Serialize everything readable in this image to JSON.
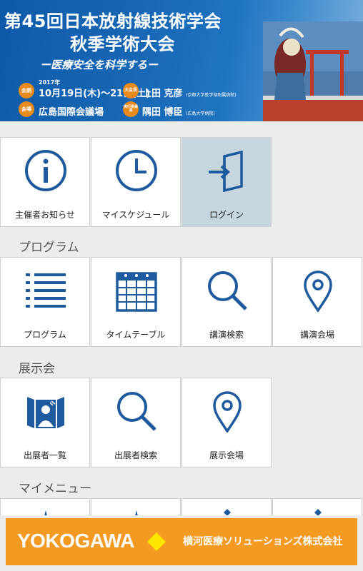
{
  "banner": {
    "title_line1": "第45回日本放射線技術学会",
    "title_line2": "秋季学術大会",
    "subtitle": "ー医療安全を科学するー",
    "session_badge": "会期",
    "year": "2017年",
    "dates": "10月19日(木)～21日(土)",
    "venue_badge": "会場",
    "venue": "広島国際会議場",
    "president_badge": "大会長",
    "president_name": "上田 克彦",
    "president_affil": "(京都大学医学部附属病院)",
    "chair_badge": "実行委員長",
    "chair_name": "隅田 博臣",
    "chair_affil": "(広島大学病院)"
  },
  "top_tiles": [
    {
      "label": "主催者お知らせ",
      "icon": "info-icon"
    },
    {
      "label": "マイスケジュール",
      "icon": "clock-icon"
    },
    {
      "label": "ログイン",
      "icon": "login-icon"
    }
  ],
  "sections": {
    "program": {
      "heading": "プログラム",
      "tiles": [
        {
          "label": "プログラム",
          "icon": "list-icon"
        },
        {
          "label": "タイムテーブル",
          "icon": "calendar-icon"
        },
        {
          "label": "講演検索",
          "icon": "search-icon"
        },
        {
          "label": "講演会場",
          "icon": "location-pin-icon"
        }
      ]
    },
    "exhibition": {
      "heading": "展示会",
      "tiles": [
        {
          "label": "出展者一覧",
          "icon": "exhibitor-icon"
        },
        {
          "label": "出展者検索",
          "icon": "search-icon"
        },
        {
          "label": "展示会場",
          "icon": "location-pin-icon"
        }
      ]
    },
    "mymenu": {
      "heading": "マイメニュー"
    }
  },
  "ad": {
    "brand": "YOKOGAWA",
    "company": "横河医療ソリューションズ株式会社"
  },
  "colors": {
    "icon_blue": "#1d5a9e",
    "active_tile": "#c5d6df",
    "ad_orange": "#f39a23",
    "banner_blue": "#1868b6",
    "badge_orange": "#e98a1c"
  }
}
